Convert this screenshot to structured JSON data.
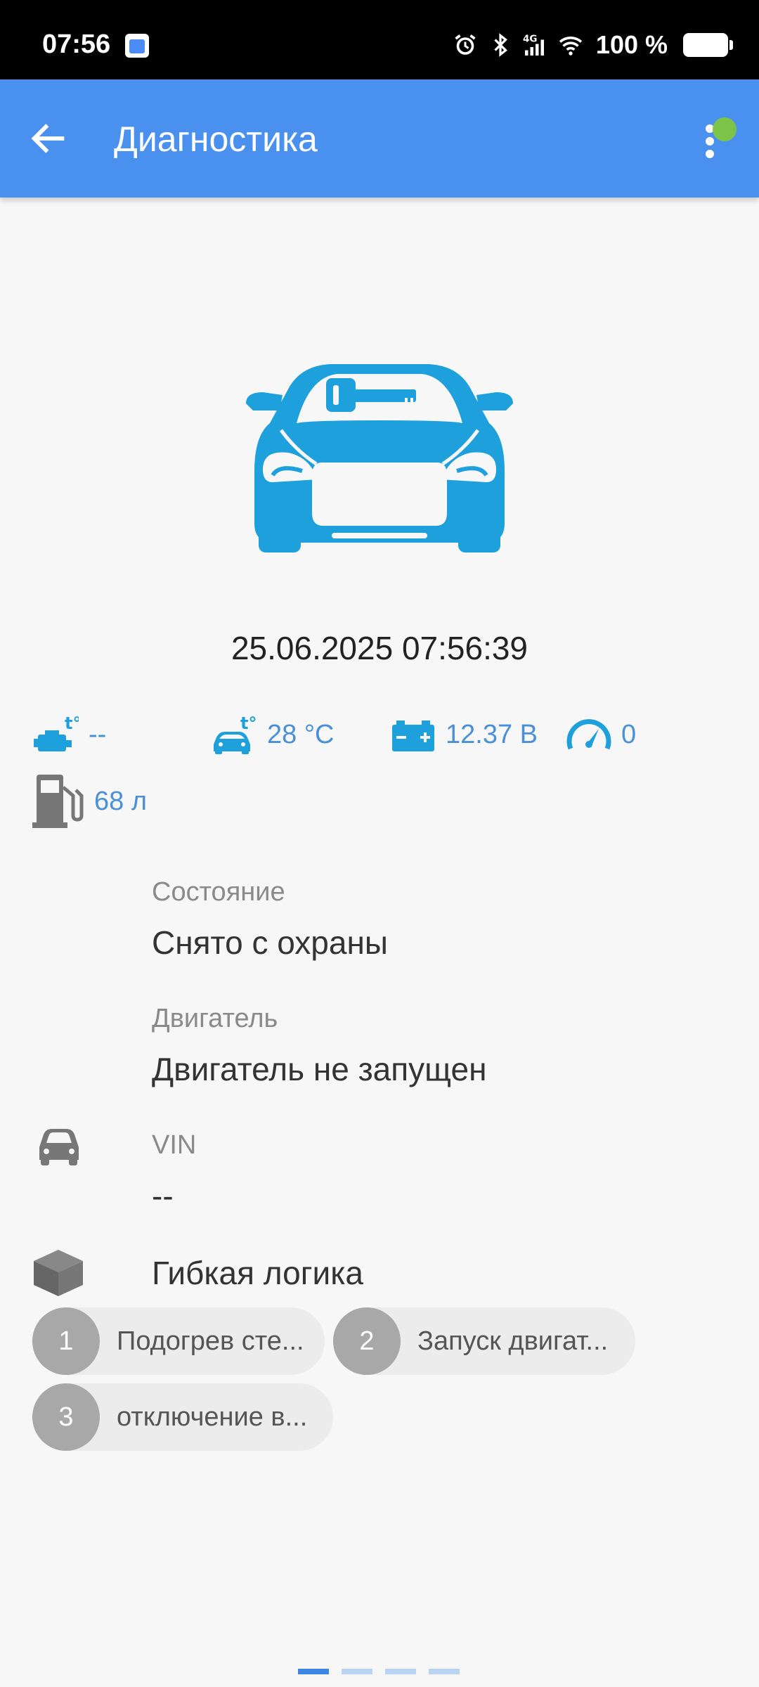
{
  "status_bar": {
    "time": "07:56",
    "battery": "100 %",
    "icons": [
      "calendar-icon",
      "alarm-icon",
      "bluetooth-icon",
      "4g-signal-icon",
      "wifi-icon",
      "battery-icon"
    ]
  },
  "app_bar": {
    "title": "Диагностика",
    "back_icon": "arrow-left-icon",
    "menu_icon": "more-vertical-icon",
    "online_color": "#7cc447"
  },
  "hero": {
    "icon": "car-key-icon",
    "color": "#1ea0dc"
  },
  "datetime": "25.06.2025  07:56:39",
  "sensors": [
    {
      "icon": "engine-temp-icon",
      "value": "--"
    },
    {
      "icon": "cabin-temp-icon",
      "value": "28 °C"
    },
    {
      "icon": "battery-voltage-icon",
      "value": "12.37 В"
    },
    {
      "icon": "speedometer-icon",
      "value": "0"
    },
    {
      "icon": "fuel-icon",
      "value": "68 л"
    }
  ],
  "info": {
    "state_label": "Состояние",
    "state_value": "Снято с охраны",
    "engine_label": "Двигатель",
    "engine_value": "Двигатель не запущен",
    "vin_label": "VIN",
    "vin_value": "--",
    "logic_label": "Гибкая логика"
  },
  "logic_chips": [
    {
      "num": "1",
      "text": "Подогрев сте..."
    },
    {
      "num": "2",
      "text": "Запуск двигат..."
    },
    {
      "num": "3",
      "text": "отключение в..."
    }
  ],
  "pager": {
    "count": 4,
    "active": 0
  },
  "colors": {
    "primary": "#4a90ee",
    "accent": "#1ea0dc",
    "sensor_text": "#4a90d6",
    "chip_bg": "#ececec",
    "chip_num": "#a8a8a8"
  }
}
